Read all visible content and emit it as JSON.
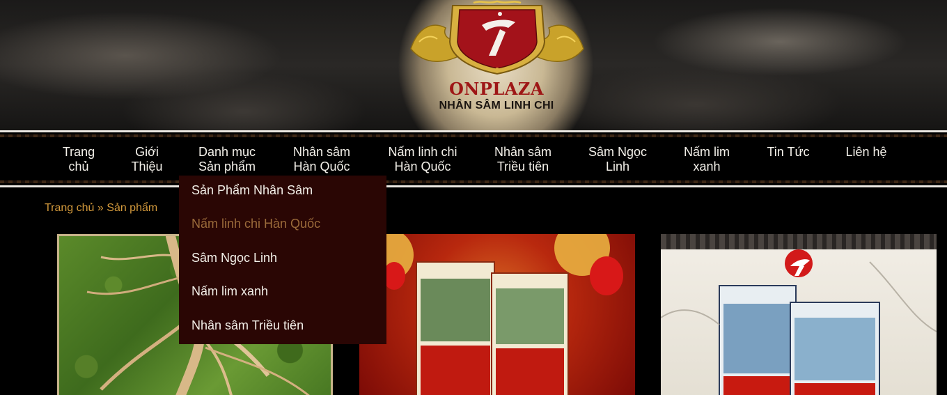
{
  "brand": {
    "name": "ONPLAZA",
    "tagline": "NHÂN SÂM LINH CHI"
  },
  "nav": {
    "items": [
      {
        "line1": "Trang",
        "line2": "chủ"
      },
      {
        "line1": "Giới",
        "line2": "Thiệu"
      },
      {
        "line1": "Danh mục",
        "line2": "Sản phẩm"
      },
      {
        "line1": "Nhân sâm",
        "line2": "Hàn Quốc"
      },
      {
        "line1": "Nấm linh chi",
        "line2": "Hàn Quốc"
      },
      {
        "line1": "Nhân sâm",
        "line2": "Triều tiên"
      },
      {
        "line1": "Sâm Ngọc",
        "line2": "Linh"
      },
      {
        "line1": "Nấm lim",
        "line2": "xanh"
      },
      {
        "line1": "Tin Tức",
        "line2": ""
      },
      {
        "line1": "Liên hệ",
        "line2": ""
      }
    ]
  },
  "dropdown": {
    "items": [
      "Sản Phẩm Nhân Sâm",
      "Nấm linh chi Hàn Quốc",
      "Sâm Ngọc Linh",
      "Nấm lim xanh",
      "Nhân sâm Triều tiên"
    ],
    "active_index": 1
  },
  "breadcrumb": {
    "home": "Trang chủ",
    "separator": "»",
    "current": "Sản phẩm"
  },
  "colors": {
    "accent": "#d49a3c",
    "brand_red": "#9e1616",
    "dropdown_bg": "#2a0604"
  }
}
